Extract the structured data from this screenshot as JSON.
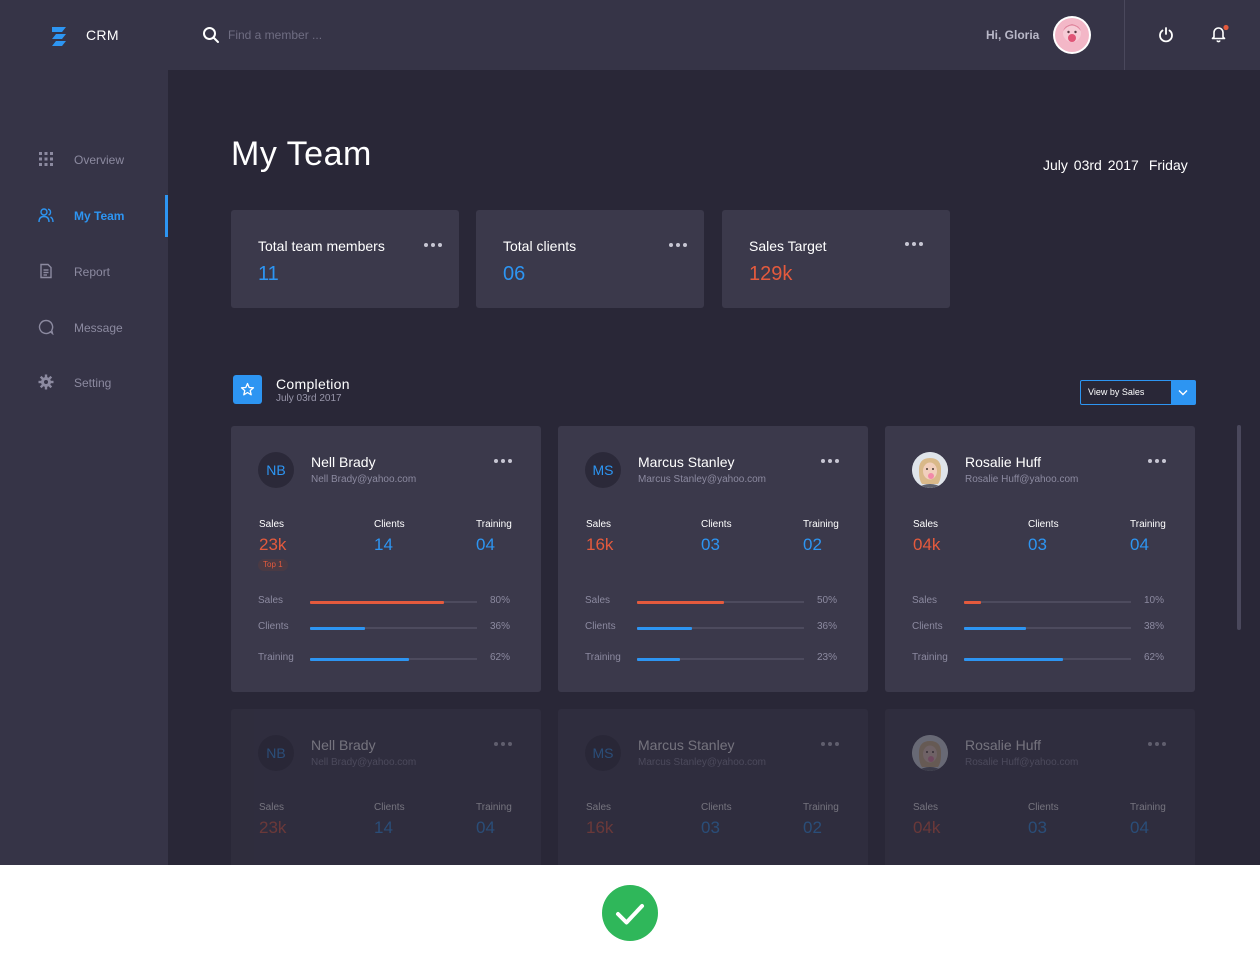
{
  "brand": "CRM",
  "search": {
    "placeholder": "Find a member ..."
  },
  "user": {
    "greeting": "Hi, Gloria"
  },
  "nav": [
    {
      "label": "Overview",
      "icon": "grid-icon",
      "active": false
    },
    {
      "label": "My Team",
      "icon": "team-icon",
      "active": true
    },
    {
      "label": "Report",
      "icon": "document-icon",
      "active": false
    },
    {
      "label": "Message",
      "icon": "message-icon",
      "active": false
    },
    {
      "label": "Setting",
      "icon": "gear-icon",
      "active": false
    }
  ],
  "page": {
    "title": "My Team",
    "date": "July 03rd  2017",
    "day": "Friday"
  },
  "stats": [
    {
      "label": "Total team members",
      "value": "11",
      "color": "#2d95f2"
    },
    {
      "label": "Total clients",
      "value": "06",
      "color": "#2d95f2"
    },
    {
      "label": "Sales Target",
      "value": "129k",
      "color": "#e45a3d"
    }
  ],
  "completion": {
    "title": "Completion",
    "date": "July 03rd  2017",
    "view_select": "View by Sales"
  },
  "column_labels": {
    "sales": "Sales",
    "clients": "Clients",
    "training": "Training"
  },
  "members": [
    {
      "initials": "NB",
      "name": "Nell Brady",
      "email": "Nell Brady@yahoo.com",
      "sales": "23k",
      "clients": "14",
      "training": "04",
      "badge": "Top 1",
      "bars": [
        {
          "label": "Sales",
          "pct": "80%",
          "value": 0.8,
          "color": "#e45a3d"
        },
        {
          "label": "Clients",
          "pct": "36%",
          "value": 0.33,
          "color": "#2d95f2"
        },
        {
          "label": "Training",
          "pct": "62%",
          "value": 0.59,
          "color": "#2d95f2"
        }
      ]
    },
    {
      "initials": "MS",
      "name": "Marcus Stanley",
      "email": "Marcus Stanley@yahoo.com",
      "sales": "16k",
      "clients": "03",
      "training": "02",
      "badge": "",
      "bars": [
        {
          "label": "Sales",
          "pct": "50%",
          "value": 0.52,
          "color": "#e45a3d"
        },
        {
          "label": "Clients",
          "pct": "36%",
          "value": 0.33,
          "color": "#2d95f2"
        },
        {
          "label": "Training",
          "pct": "23%",
          "value": 0.26,
          "color": "#2d95f2"
        }
      ]
    },
    {
      "initials": "RH",
      "photo": true,
      "name": "Rosalie Huff",
      "email": "Rosalie Huff@yahoo.com",
      "sales": "04k",
      "clients": "03",
      "training": "04",
      "badge": "",
      "bars": [
        {
          "label": "Sales",
          "pct": "10%",
          "value": 0.1,
          "color": "#e45a3d"
        },
        {
          "label": "Clients",
          "pct": "38%",
          "value": 0.37,
          "color": "#2d95f2"
        },
        {
          "label": "Training",
          "pct": "62%",
          "value": 0.59,
          "color": "#2d95f2"
        }
      ]
    }
  ],
  "colors": {
    "accent": "#2d95f2",
    "sales": "#e45a3d",
    "success": "#2fb75a"
  }
}
